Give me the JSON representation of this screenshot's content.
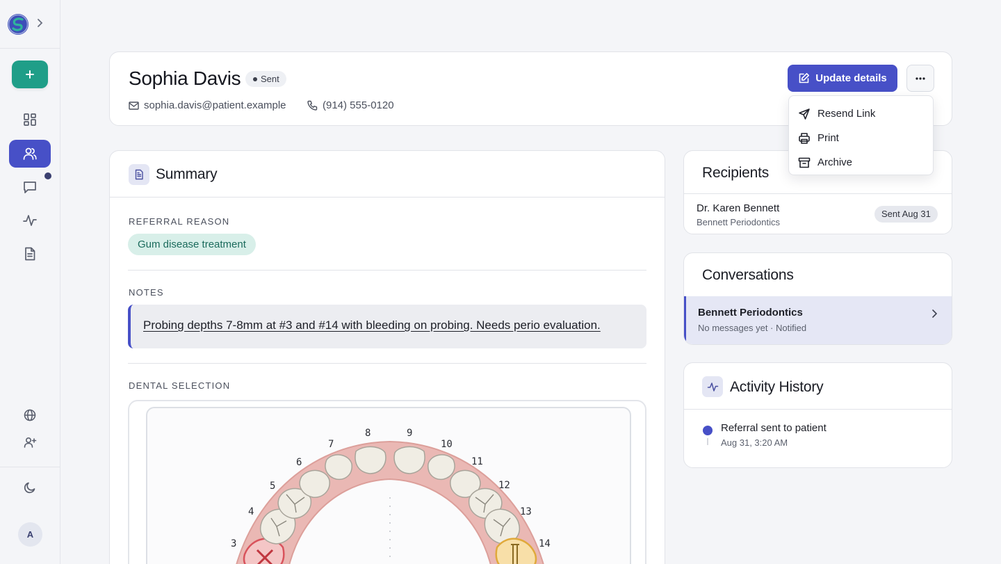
{
  "sidebar": {
    "expand_icon": "chevron-right-icon",
    "new_icon": "plus-icon",
    "nav": [
      {
        "icon": "dashboard-icon",
        "active": false
      },
      {
        "icon": "users-icon",
        "active": true
      },
      {
        "icon": "message-icon",
        "active": false
      },
      {
        "icon": "activity-icon",
        "active": false
      },
      {
        "icon": "document-icon",
        "active": false
      }
    ],
    "bottom": [
      {
        "icon": "globe-icon"
      },
      {
        "icon": "user-plus-icon"
      },
      {
        "icon": "moon-icon"
      }
    ],
    "avatar_initial": "A"
  },
  "patient": {
    "name": "Sophia Davis",
    "status": "Sent",
    "email": "sophia.davis@patient.example",
    "phone": "(914) 555-0120"
  },
  "actions": {
    "update_label": "Update details",
    "more_icon": "ellipsis-icon",
    "menu": [
      {
        "label": "Resend Link",
        "icon": "send-icon"
      },
      {
        "label": "Print",
        "icon": "printer-icon"
      },
      {
        "label": "Archive",
        "icon": "archive-icon"
      }
    ]
  },
  "summary": {
    "title": "Summary",
    "referral_label": "REFERRAL REASON",
    "referral_reason": "Gum disease treatment",
    "notes_label": "NOTES",
    "notes": "Probing depths 7-8mm at #3 and #14 with bleeding on probing. Needs perio evaluation.",
    "dental_label": "DENTAL SELECTION",
    "tooth_numbers": [
      "3",
      "4",
      "5",
      "6",
      "7",
      "8",
      "9",
      "10",
      "11",
      "12",
      "13",
      "14"
    ]
  },
  "recipients": {
    "title": "Recipients",
    "items": [
      {
        "name": "Dr. Karen Bennett",
        "practice": "Bennett Periodontics",
        "status": "Sent Aug 31"
      }
    ]
  },
  "conversations": {
    "title": "Conversations",
    "items": [
      {
        "name": "Bennett Periodontics",
        "meta": "No messages yet · Notified"
      }
    ]
  },
  "activity": {
    "title": "Activity History",
    "items": [
      {
        "text": "Referral sent to patient",
        "time": "Aug 31, 3:20 AM"
      }
    ]
  },
  "colors": {
    "primary": "#4750c7",
    "accent_green": "#1f9e88",
    "reason_bg": "#d8efe9"
  }
}
